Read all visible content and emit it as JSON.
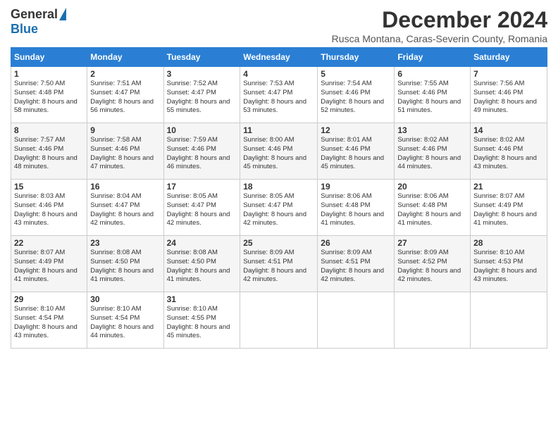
{
  "header": {
    "logo_general": "General",
    "logo_blue": "Blue",
    "title": "December 2024",
    "subtitle": "Rusca Montana, Caras-Severin County, Romania"
  },
  "calendar": {
    "days_of_week": [
      "Sunday",
      "Monday",
      "Tuesday",
      "Wednesday",
      "Thursday",
      "Friday",
      "Saturday"
    ],
    "weeks": [
      [
        null,
        null,
        null,
        null,
        null,
        null,
        null
      ]
    ],
    "cells": [
      {
        "day": 1,
        "col": 0,
        "sunrise": "7:50 AM",
        "sunset": "4:48 PM",
        "daylight": "8 hours and 58 minutes."
      },
      {
        "day": 2,
        "col": 1,
        "sunrise": "7:51 AM",
        "sunset": "4:47 PM",
        "daylight": "8 hours and 56 minutes."
      },
      {
        "day": 3,
        "col": 2,
        "sunrise": "7:52 AM",
        "sunset": "4:47 PM",
        "daylight": "8 hours and 55 minutes."
      },
      {
        "day": 4,
        "col": 3,
        "sunrise": "7:53 AM",
        "sunset": "4:47 PM",
        "daylight": "8 hours and 53 minutes."
      },
      {
        "day": 5,
        "col": 4,
        "sunrise": "7:54 AM",
        "sunset": "4:46 PM",
        "daylight": "8 hours and 52 minutes."
      },
      {
        "day": 6,
        "col": 5,
        "sunrise": "7:55 AM",
        "sunset": "4:46 PM",
        "daylight": "8 hours and 51 minutes."
      },
      {
        "day": 7,
        "col": 6,
        "sunrise": "7:56 AM",
        "sunset": "4:46 PM",
        "daylight": "8 hours and 49 minutes."
      },
      {
        "day": 8,
        "col": 0,
        "sunrise": "7:57 AM",
        "sunset": "4:46 PM",
        "daylight": "8 hours and 48 minutes."
      },
      {
        "day": 9,
        "col": 1,
        "sunrise": "7:58 AM",
        "sunset": "4:46 PM",
        "daylight": "8 hours and 47 minutes."
      },
      {
        "day": 10,
        "col": 2,
        "sunrise": "7:59 AM",
        "sunset": "4:46 PM",
        "daylight": "8 hours and 46 minutes."
      },
      {
        "day": 11,
        "col": 3,
        "sunrise": "8:00 AM",
        "sunset": "4:46 PM",
        "daylight": "8 hours and 45 minutes."
      },
      {
        "day": 12,
        "col": 4,
        "sunrise": "8:01 AM",
        "sunset": "4:46 PM",
        "daylight": "8 hours and 45 minutes."
      },
      {
        "day": 13,
        "col": 5,
        "sunrise": "8:02 AM",
        "sunset": "4:46 PM",
        "daylight": "8 hours and 44 minutes."
      },
      {
        "day": 14,
        "col": 6,
        "sunrise": "8:02 AM",
        "sunset": "4:46 PM",
        "daylight": "8 hours and 43 minutes."
      },
      {
        "day": 15,
        "col": 0,
        "sunrise": "8:03 AM",
        "sunset": "4:46 PM",
        "daylight": "8 hours and 43 minutes."
      },
      {
        "day": 16,
        "col": 1,
        "sunrise": "8:04 AM",
        "sunset": "4:47 PM",
        "daylight": "8 hours and 42 minutes."
      },
      {
        "day": 17,
        "col": 2,
        "sunrise": "8:05 AM",
        "sunset": "4:47 PM",
        "daylight": "8 hours and 42 minutes."
      },
      {
        "day": 18,
        "col": 3,
        "sunrise": "8:05 AM",
        "sunset": "4:47 PM",
        "daylight": "8 hours and 42 minutes."
      },
      {
        "day": 19,
        "col": 4,
        "sunrise": "8:06 AM",
        "sunset": "4:48 PM",
        "daylight": "8 hours and 41 minutes."
      },
      {
        "day": 20,
        "col": 5,
        "sunrise": "8:06 AM",
        "sunset": "4:48 PM",
        "daylight": "8 hours and 41 minutes."
      },
      {
        "day": 21,
        "col": 6,
        "sunrise": "8:07 AM",
        "sunset": "4:49 PM",
        "daylight": "8 hours and 41 minutes."
      },
      {
        "day": 22,
        "col": 0,
        "sunrise": "8:07 AM",
        "sunset": "4:49 PM",
        "daylight": "8 hours and 41 minutes."
      },
      {
        "day": 23,
        "col": 1,
        "sunrise": "8:08 AM",
        "sunset": "4:50 PM",
        "daylight": "8 hours and 41 minutes."
      },
      {
        "day": 24,
        "col": 2,
        "sunrise": "8:08 AM",
        "sunset": "4:50 PM",
        "daylight": "8 hours and 41 minutes."
      },
      {
        "day": 25,
        "col": 3,
        "sunrise": "8:09 AM",
        "sunset": "4:51 PM",
        "daylight": "8 hours and 42 minutes."
      },
      {
        "day": 26,
        "col": 4,
        "sunrise": "8:09 AM",
        "sunset": "4:51 PM",
        "daylight": "8 hours and 42 minutes."
      },
      {
        "day": 27,
        "col": 5,
        "sunrise": "8:09 AM",
        "sunset": "4:52 PM",
        "daylight": "8 hours and 42 minutes."
      },
      {
        "day": 28,
        "col": 6,
        "sunrise": "8:10 AM",
        "sunset": "4:53 PM",
        "daylight": "8 hours and 43 minutes."
      },
      {
        "day": 29,
        "col": 0,
        "sunrise": "8:10 AM",
        "sunset": "4:54 PM",
        "daylight": "8 hours and 43 minutes."
      },
      {
        "day": 30,
        "col": 1,
        "sunrise": "8:10 AM",
        "sunset": "4:54 PM",
        "daylight": "8 hours and 44 minutes."
      },
      {
        "day": 31,
        "col": 2,
        "sunrise": "8:10 AM",
        "sunset": "4:55 PM",
        "daylight": "8 hours and 45 minutes."
      }
    ]
  }
}
